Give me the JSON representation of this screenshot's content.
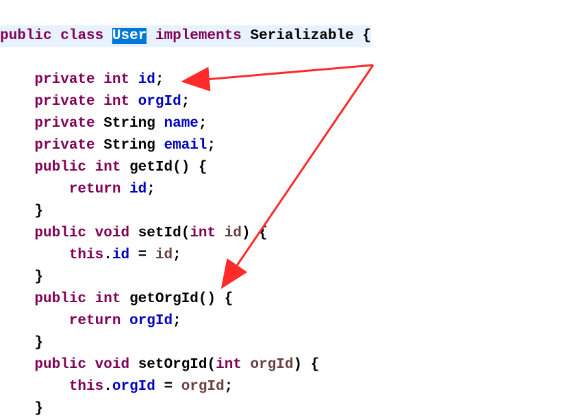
{
  "line1_prefix": "public",
  "line1_class": "class",
  "line1_user": "User",
  "line1_impl": "implements",
  "line1_ser": "Serializable {",
  "priv": "private",
  "pub": "public",
  "int": "int",
  "void": "void",
  "string": "String",
  "ret": "return",
  "this": "this",
  "f_id": "id",
  "f_orgId": "orgId",
  "f_name": "name",
  "f_email": "email",
  "m_getId": "getId() {",
  "m_setId": "setId(",
  "m_getOrgId": "getOrgId() {",
  "m_setOrgId": "setOrgId(",
  "p_id": "id",
  "p_orgId": "orgId",
  "cparen_brace": ") {",
  "semi": ";",
  "brace_c": "}",
  "eq": " = ",
  "dot": "."
}
